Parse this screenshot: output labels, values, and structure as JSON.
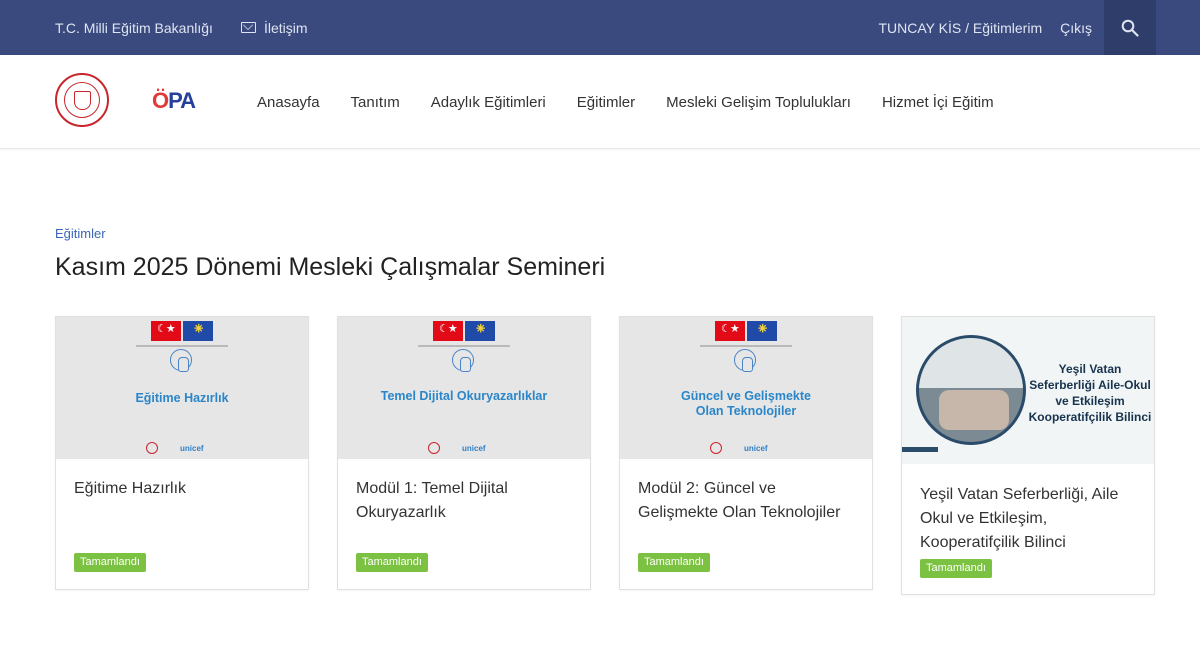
{
  "topbar": {
    "ministry_link": "T.C. Milli Eğitim Bakanlığı",
    "contact_link": "İletişim",
    "user_link": "TUNCAY KİS / Eğitimlerim",
    "logout_link": "Çıkış",
    "search_icon": "search-icon",
    "background_color": "#3a4a7e"
  },
  "navbar": {
    "logo_opa": "OPA",
    "menu": [
      "Anasayfa",
      "Tanıtım",
      "Adaylık Eğitimleri",
      "Eğitimler",
      "Mesleki Gelişim Toplulukları",
      "Hizmet İçi Eğitim"
    ]
  },
  "breadcrumb": "Eğitimler",
  "page_title": "Kasım 2025 Dönemi Mesleki Çalışmalar Semineri",
  "cards": [
    {
      "thumb_title": "Eğitime Hazırlık",
      "title": "Eğitime Hazırlık",
      "status": "Tamamlandı"
    },
    {
      "thumb_title": "Temel Dijital Okuryazarlıklar",
      "title": "Modül 1: Temel Dijital Okuryazarlık",
      "status": "Tamamlandı"
    },
    {
      "thumb_title": "Güncel ve Gelişmekte Olan Teknolojiler",
      "title": "Modül 2: Güncel ve Gelişmekte Olan Teknolojiler",
      "status": "Tamamlandı"
    },
    {
      "thumb_title": "Yeşil Vatan Seferberliği Aile-Okul ve Etkileşim Kooperatifçilik Bilinci",
      "title": "Yeşil Vatan Seferberliği, Aile Okul ve Etkileşim, Kooperatifçilik Bilinci",
      "status": "Tamamlandı"
    }
  ],
  "colors": {
    "accent": "#3a67b7",
    "badge": "#7cc242",
    "thumb_title": "#2a86c9"
  }
}
